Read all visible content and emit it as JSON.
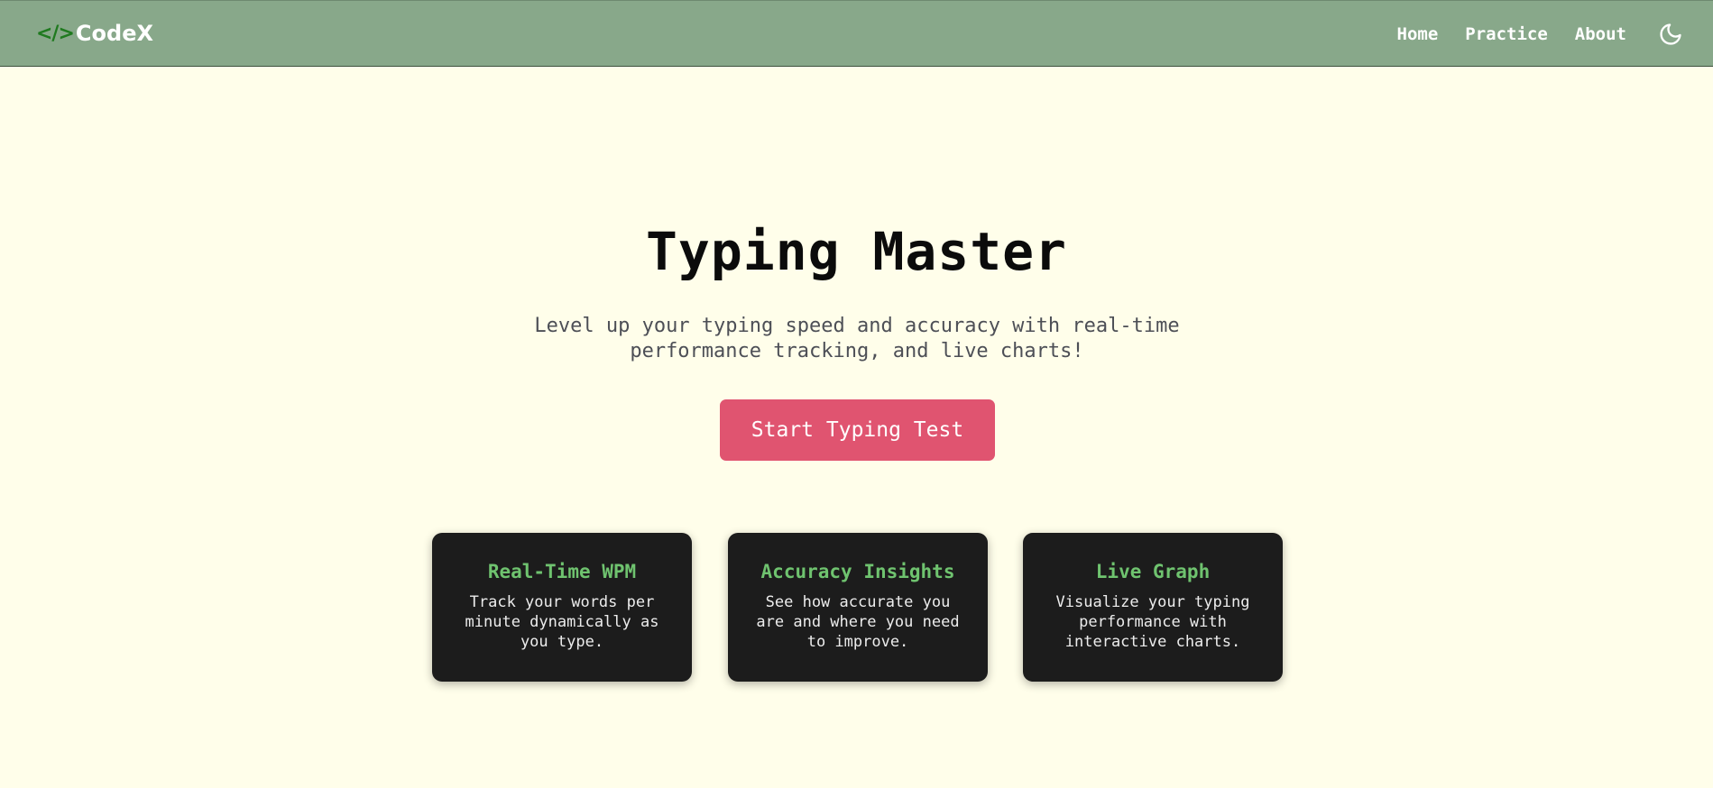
{
  "nav": {
    "logo_mark": "</>",
    "logo_text": "CodeX",
    "links": [
      {
        "label": "Home"
      },
      {
        "label": "Practice"
      },
      {
        "label": "About"
      }
    ],
    "theme_icon": "moon-icon"
  },
  "hero": {
    "title": "Typing Master",
    "subtitle": "Level up your typing speed and accuracy with real-time performance tracking, and live charts!",
    "cta_label": "Start Typing Test"
  },
  "features": [
    {
      "title": "Real-Time WPM",
      "text": "Track your words per minute dynamically as you type."
    },
    {
      "title": "Accuracy Insights",
      "text": "See how accurate you are and where you need to improve."
    },
    {
      "title": "Live Graph",
      "text": "Visualize your typing performance with interactive charts."
    }
  ],
  "colors": {
    "navbar": "#88a88a",
    "page_background": "#fffeea",
    "cta": "#e05470",
    "card_background": "#1c1c1c",
    "card_title": "#6fc36f"
  }
}
